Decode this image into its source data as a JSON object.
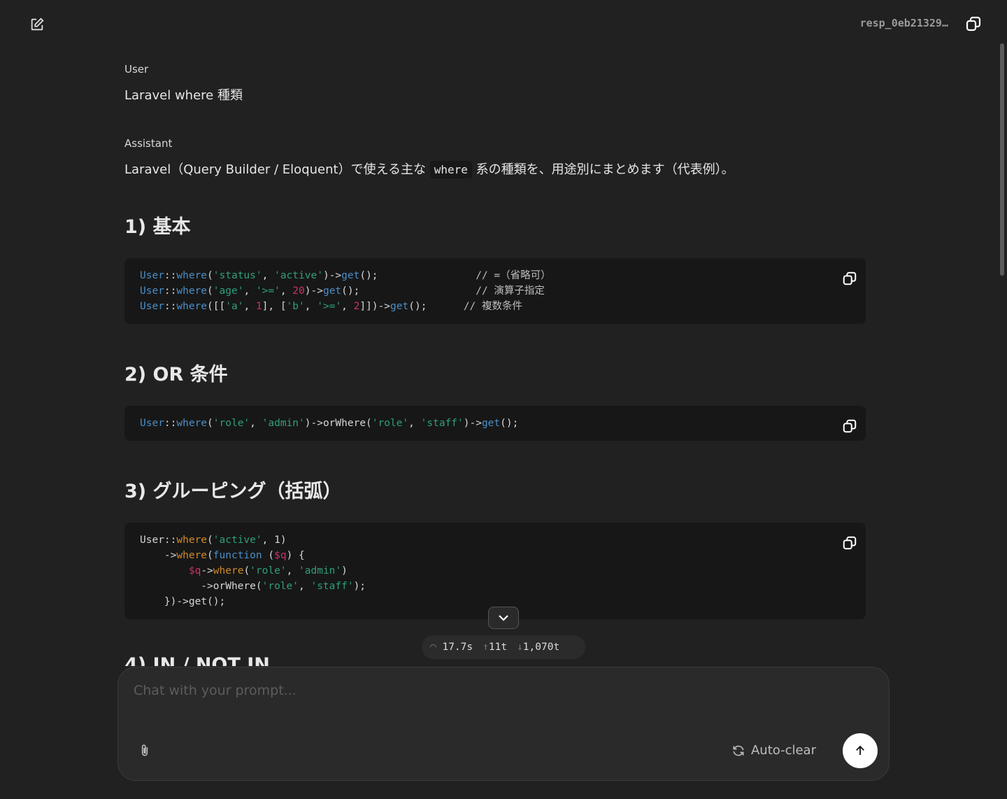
{
  "header": {
    "response_id": "resp_0eb21329…"
  },
  "messages": [
    {
      "role": "User",
      "text": "Laravel where 種類"
    },
    {
      "role": "Assistant",
      "intro_before": "Laravel（Query Builder / Eloquent）で使える主な ",
      "intro_code": "where",
      "intro_after": " 系の種類を、用途別にまとめます（代表例）。"
    }
  ],
  "sections": [
    {
      "title": "1) 基本",
      "code": [
        [
          [
            "User",
            "cls"
          ],
          [
            "::",
            "pl"
          ],
          [
            "where",
            "fn"
          ],
          [
            "(",
            "pl"
          ],
          [
            "'status'",
            "str"
          ],
          [
            ", ",
            "pl"
          ],
          [
            "'active'",
            "str"
          ],
          [
            ")->",
            "pl"
          ],
          [
            "get",
            "fn"
          ],
          [
            "();                ",
            "pl"
          ],
          [
            "// =（省略可）",
            "cm"
          ]
        ],
        [
          [
            "User",
            "cls"
          ],
          [
            "::",
            "pl"
          ],
          [
            "where",
            "fn"
          ],
          [
            "(",
            "pl"
          ],
          [
            "'age'",
            "str"
          ],
          [
            ", ",
            "pl"
          ],
          [
            "'>='",
            "str"
          ],
          [
            ", ",
            "pl"
          ],
          [
            "20",
            "num"
          ],
          [
            ")->",
            "pl"
          ],
          [
            "get",
            "fn"
          ],
          [
            "();                   ",
            "pl"
          ],
          [
            "// 演算子指定",
            "cm"
          ]
        ],
        [
          [
            "User",
            "cls"
          ],
          [
            "::",
            "pl"
          ],
          [
            "where",
            "fn"
          ],
          [
            "([[",
            "pl"
          ],
          [
            "'a'",
            "str"
          ],
          [
            ", ",
            "pl"
          ],
          [
            "1",
            "num"
          ],
          [
            "], [",
            "pl"
          ],
          [
            "'b'",
            "str"
          ],
          [
            ", ",
            "pl"
          ],
          [
            "'>='",
            "str"
          ],
          [
            ", ",
            "pl"
          ],
          [
            "2",
            "num"
          ],
          [
            "]])->",
            "pl"
          ],
          [
            "get",
            "fn"
          ],
          [
            "();      ",
            "pl"
          ],
          [
            "// 複数条件",
            "cm"
          ]
        ]
      ]
    },
    {
      "title": "2) OR 条件",
      "code": [
        [
          [
            "User",
            "cls"
          ],
          [
            "::",
            "pl"
          ],
          [
            "where",
            "fn"
          ],
          [
            "(",
            "pl"
          ],
          [
            "'role'",
            "str"
          ],
          [
            ", ",
            "pl"
          ],
          [
            "'admin'",
            "str"
          ],
          [
            ")->orWhere(",
            "pl"
          ],
          [
            "'role'",
            "str"
          ],
          [
            ", ",
            "pl"
          ],
          [
            "'staff'",
            "str"
          ],
          [
            ")->",
            "pl"
          ],
          [
            "get",
            "fn"
          ],
          [
            "();",
            "pl"
          ]
        ]
      ]
    },
    {
      "title": "3) グルーピング（括弧）",
      "code": [
        [
          [
            "User::",
            "pl"
          ],
          [
            "where",
            "or"
          ],
          [
            "(",
            "pl"
          ],
          [
            "'active'",
            "str"
          ],
          [
            ", 1)",
            "pl"
          ]
        ],
        [
          [
            "    ->",
            "pl"
          ],
          [
            "where",
            "or"
          ],
          [
            "(",
            "pl"
          ],
          [
            "function",
            "fn"
          ],
          [
            " (",
            "pl"
          ],
          [
            "$q",
            "var"
          ],
          [
            ") {",
            "pl"
          ]
        ],
        [
          [
            "        ",
            "pl"
          ],
          [
            "$q",
            "var"
          ],
          [
            "->",
            "pl"
          ],
          [
            "where",
            "or"
          ],
          [
            "(",
            "pl"
          ],
          [
            "'role'",
            "str"
          ],
          [
            ", ",
            "pl"
          ],
          [
            "'admin'",
            "str"
          ],
          [
            ")",
            "pl"
          ]
        ],
        [
          [
            "          ->orWhere(",
            "pl"
          ],
          [
            "'role'",
            "str"
          ],
          [
            ", ",
            "pl"
          ],
          [
            "'staff'",
            "str"
          ],
          [
            ");",
            "pl"
          ]
        ],
        [
          [
            "    })->get();",
            "pl"
          ]
        ]
      ]
    },
    {
      "title": "4) IN / NOT IN",
      "code": []
    }
  ],
  "stats": {
    "time": "17.7s",
    "tokens_in": "11t",
    "tokens_out": "1,070t"
  },
  "composer": {
    "placeholder": "Chat with your prompt...",
    "auto_clear": "Auto-clear"
  }
}
